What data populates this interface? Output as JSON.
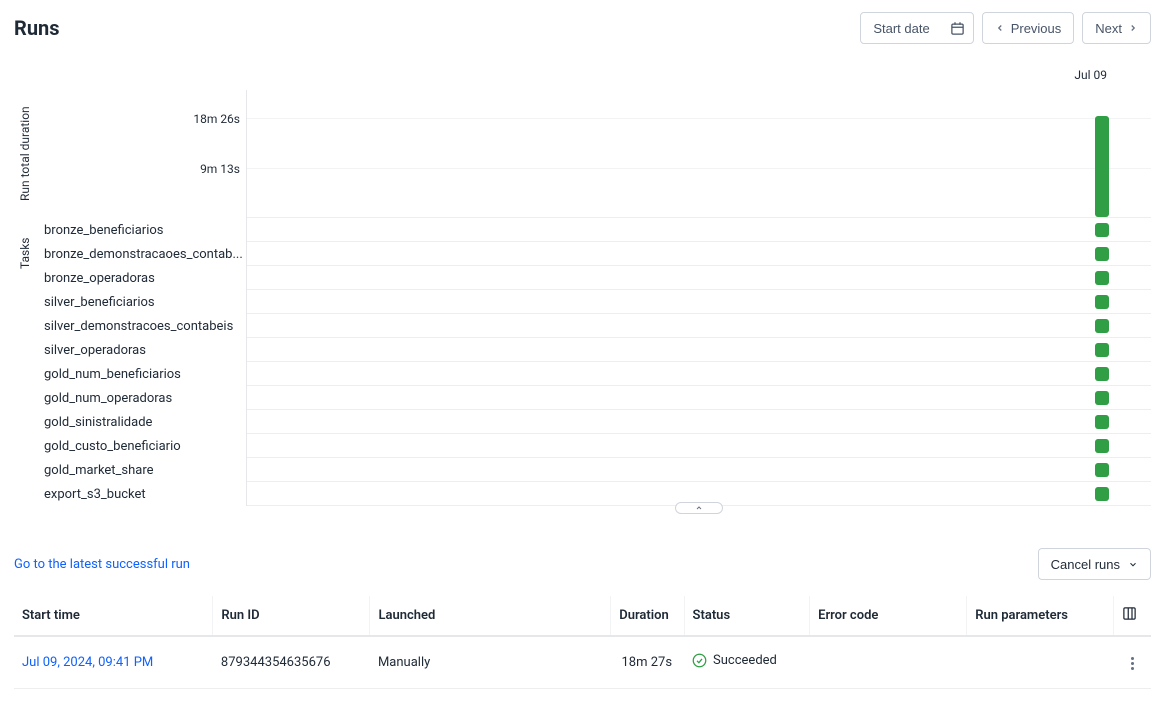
{
  "header": {
    "title": "Runs",
    "date_picker_label": "Start date",
    "prev_label": "Previous",
    "next_label": "Next"
  },
  "chart": {
    "duration_axis_label": "Run total duration",
    "tasks_axis_label": "Tasks",
    "duration_ticks": [
      "18m 26s",
      "9m 13s"
    ],
    "run_date_label": "Jul 09",
    "tasks": [
      "bronze_beneficiarios",
      "bronze_demonstracaoes_contab...",
      "bronze_operadoras",
      "silver_beneficiarios",
      "silver_demonstracoes_contabeis",
      "silver_operadoras",
      "gold_num_beneficiarios",
      "gold_num_operadoras",
      "gold_sinistralidade",
      "gold_custo_beneficiario",
      "gold_market_share",
      "export_s3_bucket"
    ],
    "status_color": "#2f9e44"
  },
  "actions": {
    "latest_run_link": "Go to the latest successful run",
    "cancel_runs_label": "Cancel runs"
  },
  "table": {
    "columns": {
      "start_time": "Start time",
      "run_id": "Run ID",
      "launched": "Launched",
      "duration": "Duration",
      "status": "Status",
      "error_code": "Error code",
      "run_parameters": "Run parameters"
    },
    "rows": [
      {
        "start_time": "Jul 09, 2024, 09:41 PM",
        "run_id": "879344354635676",
        "launched": "Manually",
        "duration": "18m 27s",
        "status": "Succeeded",
        "error_code": "",
        "run_parameters": ""
      }
    ]
  },
  "chart_data": {
    "type": "bar",
    "title": "Runs",
    "ylabel": "Run total duration",
    "ylim": [
      0,
      1106
    ],
    "categories": [
      "Jul 09"
    ],
    "series": [
      {
        "name": "total",
        "values": [
          1106
        ]
      }
    ],
    "task_status": [
      {
        "task": "bronze_beneficiarios",
        "status": "Succeeded"
      },
      {
        "task": "bronze_demonstracaoes_contab...",
        "status": "Succeeded"
      },
      {
        "task": "bronze_operadoras",
        "status": "Succeeded"
      },
      {
        "task": "silver_beneficiarios",
        "status": "Succeeded"
      },
      {
        "task": "silver_demonstracoes_contabeis",
        "status": "Succeeded"
      },
      {
        "task": "silver_operadoras",
        "status": "Succeeded"
      },
      {
        "task": "gold_num_beneficiarios",
        "status": "Succeeded"
      },
      {
        "task": "gold_num_operadoras",
        "status": "Succeeded"
      },
      {
        "task": "gold_sinistralidade",
        "status": "Succeeded"
      },
      {
        "task": "gold_custo_beneficiario",
        "status": "Succeeded"
      },
      {
        "task": "gold_market_share",
        "status": "Succeeded"
      },
      {
        "task": "export_s3_bucket",
        "status": "Succeeded"
      }
    ]
  }
}
